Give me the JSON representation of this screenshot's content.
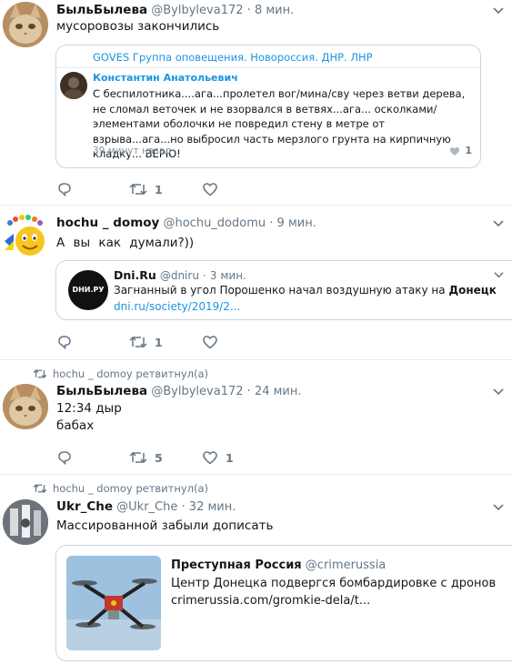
{
  "tweets": [
    {
      "name": "БыльБылева",
      "handle": "@Bylbyleva172",
      "time": "8 мин.",
      "text": "мусоровозы закончились",
      "quote": {
        "header": "GOVES Группа оповещения. Новороссия. ДНР. ЛНР",
        "inner_name": "Константин Анатольевич",
        "inner_text": "С беспилотника....ага...пролетел вог/мина/сву через ветви дерева, не сломал веточек и не взорвался в ветвях...ага... осколками/элементами оболочки не повредил стену в метре от взрыва...ага...но выбросил часть мерзлого грунта на кирпичную кладку... ВЕРЮ!",
        "inner_time": "39 минут назад",
        "inner_likes": "1"
      },
      "reply_count": "",
      "retweet_count": "1",
      "like_count": ""
    },
    {
      "name": "hochu _ domoy",
      "handle": "@hochu_dodomu",
      "time": "9 мин.",
      "text": "А вы как думали?))",
      "quote": {
        "name": "Dni.Ru",
        "handle": "@dniru",
        "time": "3 мин.",
        "text_prefix": "Загнанный в угол Порошенко начал воздушную атаку на ",
        "text_bold": "Донецк",
        "link": "dni.ru/society/2019/2...",
        "logo_text": "DНИ.РУ"
      },
      "reply_count": "",
      "retweet_count": "1",
      "like_count": ""
    },
    {
      "retweeted_by": "hochu _ domoy ретвитнул(а)",
      "name": "БыльБылева",
      "handle": "@Bylbyleva172",
      "time": "24 мин.",
      "text_lines": [
        "12:34 дыр",
        "бабах"
      ],
      "reply_count": "",
      "retweet_count": "5",
      "like_count": "1"
    },
    {
      "retweeted_by": "hochu _ domoy ретвитнул(а)",
      "name": "Ukr_Che",
      "handle": "@Ukr_Che",
      "time": "32 мин.",
      "text": "Массированной забыли дописать",
      "card": {
        "name": "Преступная Россия",
        "handle": "@crimerussia",
        "text": "Центр Донецка подвергся бомбардировке с дронов",
        "link": "crimerussia.com/gromkie-dela/t..."
      }
    }
  ],
  "dot": "·",
  "colors": {
    "text": "#14171a",
    "secondary": "#657786",
    "link": "#1b95e0",
    "border": "#e6ecf0"
  }
}
